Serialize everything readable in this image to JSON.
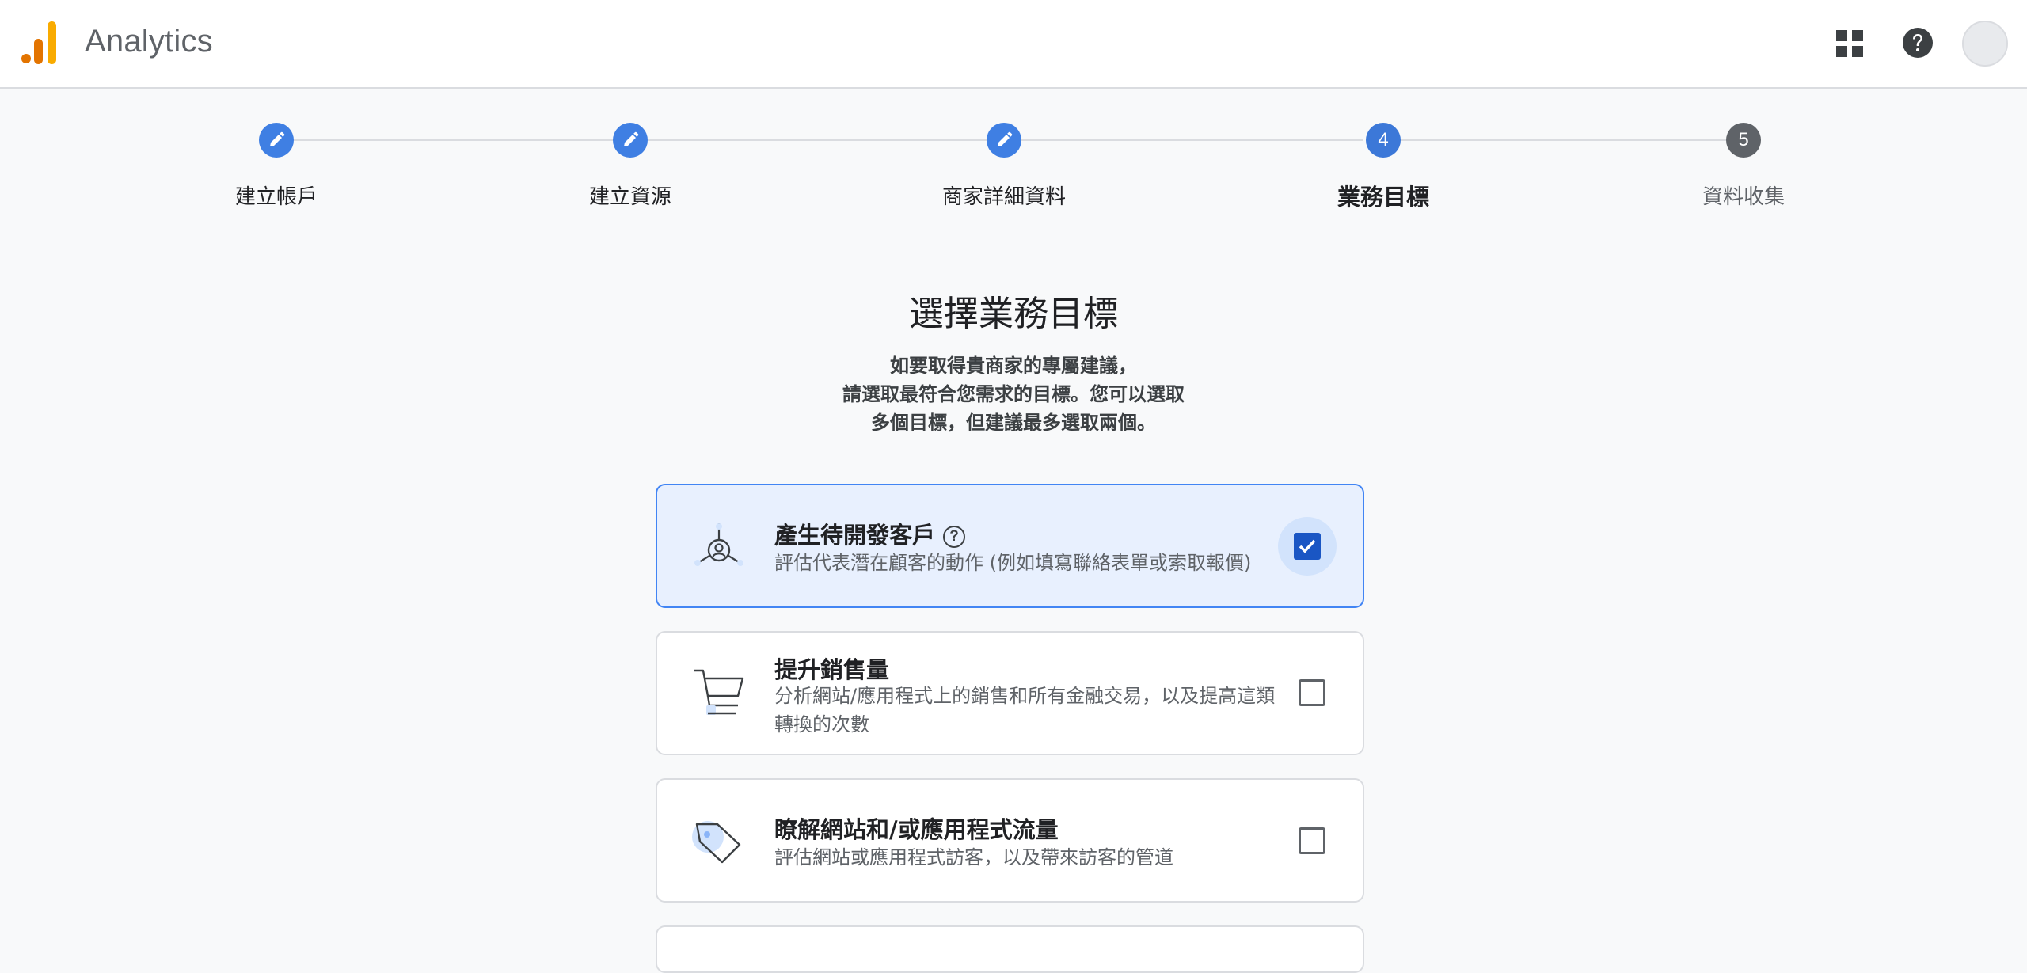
{
  "app": {
    "title": "Analytics",
    "brand_colors": [
      "#f9ab00",
      "#e37400"
    ]
  },
  "header": {
    "icons": [
      "apps-grid-icon",
      "help-icon",
      "account-avatar"
    ]
  },
  "stepper": {
    "steps": [
      {
        "number": "",
        "label": "建立帳戶",
        "state": "done"
      },
      {
        "number": "",
        "label": "建立資源",
        "state": "done"
      },
      {
        "number": "",
        "label": "商家詳細資料",
        "state": "done"
      },
      {
        "number": "4",
        "label": "業務目標",
        "state": "current"
      },
      {
        "number": "5",
        "label": "資料收集",
        "state": "todo"
      }
    ]
  },
  "main": {
    "title": "選擇業務目標",
    "intro_lines": [
      "如要取得貴商家的專屬建議，",
      "請選取最符合您需求的目標。您可以選取",
      "多個目標，但建議最多選取兩個。"
    ],
    "goals": [
      {
        "title": "產生待開發客戶",
        "has_help": true,
        "description": "評估代表潛在顧客的動作 (例如填寫聯絡表單或索取報價)",
        "checked": true,
        "icon": "leads-icon"
      },
      {
        "title": "提升銷售量",
        "has_help": false,
        "description": "分析網站/應用程式上的銷售和所有金融交易，以及提高這類轉換的次數",
        "checked": false,
        "icon": "shopping-cart-icon"
      },
      {
        "title": "瞭解網站和/或應用程式流量",
        "has_help": false,
        "description": "評估網站或應用程式訪客，以及帶來訪客的管道",
        "checked": false,
        "icon": "tag-icon"
      }
    ]
  },
  "colors": {
    "accent": "#1a73e8",
    "selected_card_bg": "#e8f0fe",
    "checked_box": "#1a56c4"
  }
}
